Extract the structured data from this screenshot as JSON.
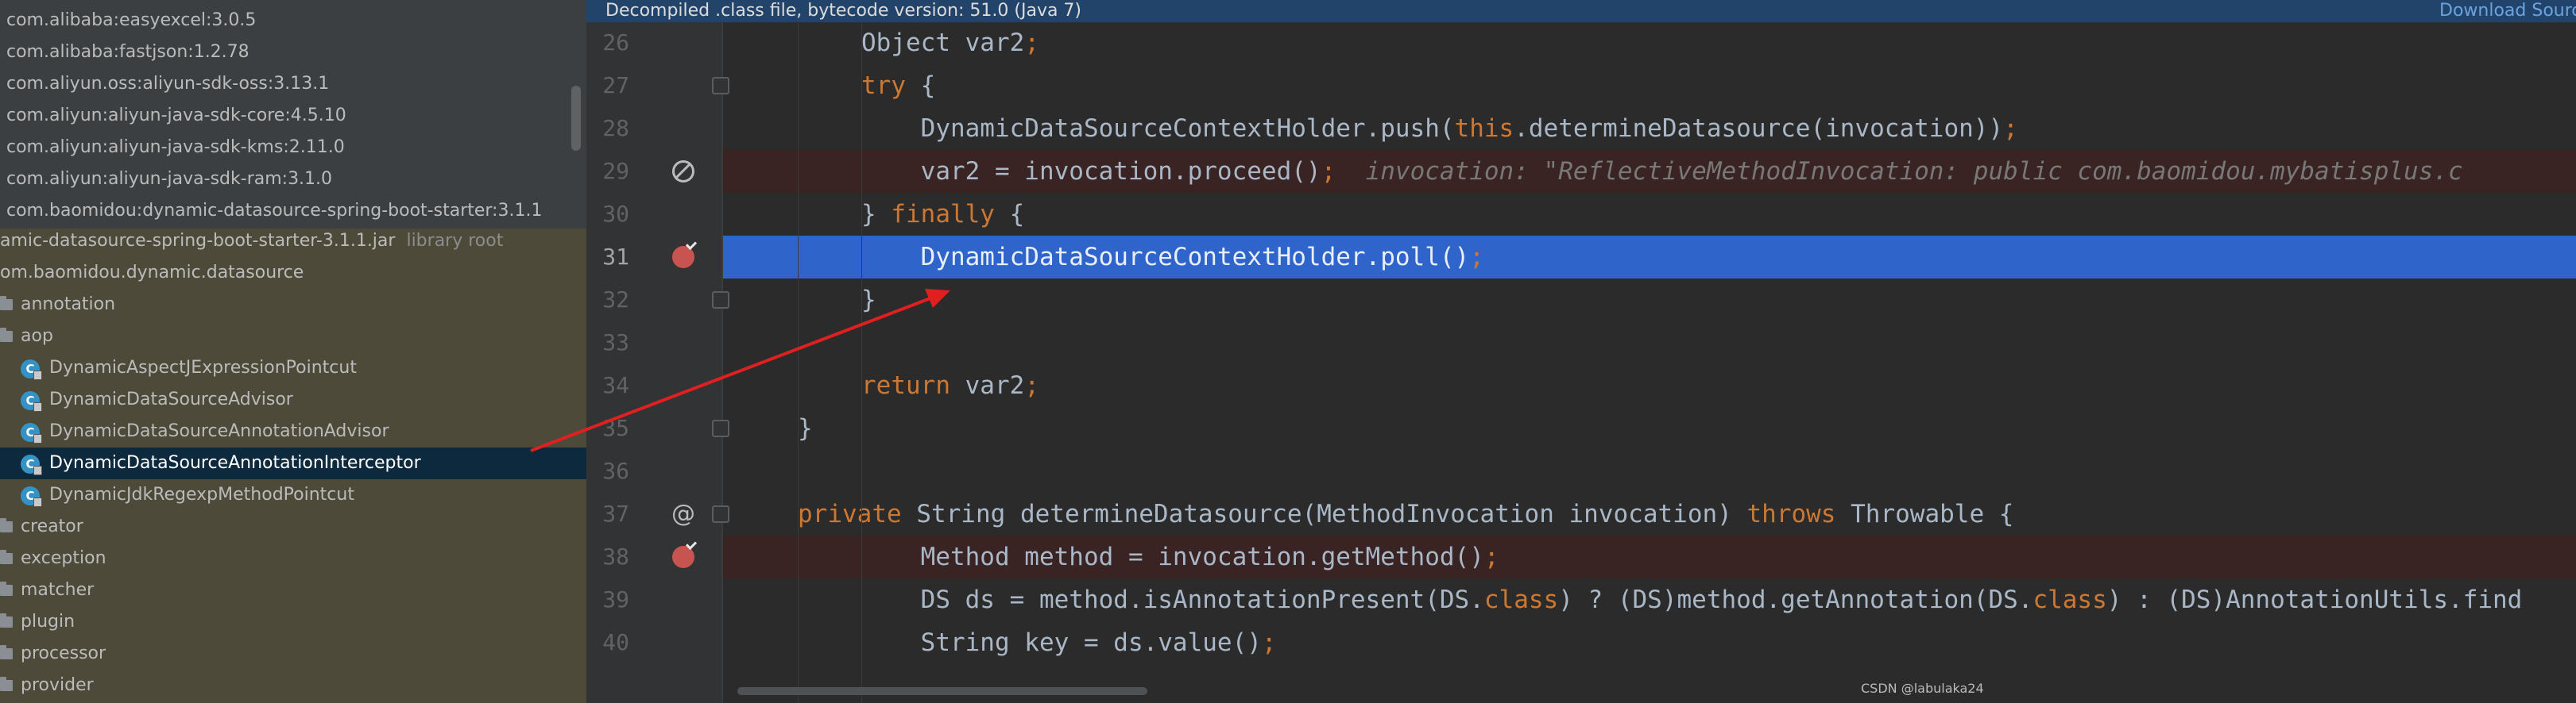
{
  "tree": {
    "dependencies": [
      "com.alibaba:easyexcel:3.0.5",
      "com.alibaba:fastjson:1.2.78",
      "com.aliyun.oss:aliyun-sdk-oss:3.13.1",
      "com.aliyun:aliyun-java-sdk-core:4.5.10",
      "com.aliyun:aliyun-java-sdk-kms:2.11.0",
      "com.aliyun:aliyun-java-sdk-ram:3.1.0",
      "com.baomidou:dynamic-datasource-spring-boot-starter:3.1.1"
    ],
    "jar": {
      "name": "amic-datasource-spring-boot-starter-3.1.1.jar",
      "hint": "library root"
    },
    "package": "om.baomidou.dynamic.datasource",
    "folders_top": [
      "annotation",
      "aop"
    ],
    "aop_classes": [
      "DynamicAspectJExpressionPointcut",
      "DynamicDataSourceAdvisor",
      "DynamicDataSourceAnnotationAdvisor",
      "DynamicDataSourceAnnotationInterceptor",
      "DynamicJdkRegexpMethodPointcut"
    ],
    "folders_bottom": [
      "creator",
      "exception",
      "matcher",
      "plugin",
      "processor",
      "provider"
    ],
    "class_icon_letter": "C",
    "selected": "DynamicDataSourceAnnotationInterceptor"
  },
  "editor": {
    "notice": "Decompiled .class file, bytecode version: 51.0 (Java 7)",
    "notice_link": "Download Sources",
    "lines": [
      {
        "n": "26",
        "parts": [
          {
            "t": "Object var2",
            "c": ""
          },
          {
            "t": ";",
            "c": "sc"
          }
        ]
      },
      {
        "n": "27",
        "parts": [
          {
            "t": "try",
            "c": "kw"
          },
          {
            "t": " {",
            "c": ""
          }
        ]
      },
      {
        "n": "28",
        "parts": [
          {
            "t": "    DynamicDataSourceContextHolder.push(",
            "c": ""
          },
          {
            "t": "this",
            "c": "kw"
          },
          {
            "t": ".determineDatasource(invocation))",
            "c": ""
          },
          {
            "t": ";",
            "c": "sc"
          }
        ]
      },
      {
        "n": "29",
        "parts": [
          {
            "t": "    var2 = invocation.proceed()",
            "c": ""
          },
          {
            "t": ";",
            "c": "sc"
          },
          {
            "t": "  invocation: \"ReflectiveMethodInvocation: public com.baomidou.mybatisplus.c",
            "c": "cm"
          }
        ]
      },
      {
        "n": "30",
        "parts": [
          {
            "t": "} ",
            "c": ""
          },
          {
            "t": "finally",
            "c": "kw"
          },
          {
            "t": " {",
            "c": ""
          }
        ]
      },
      {
        "n": "31",
        "parts": [
          {
            "t": "    DynamicDataSourceContextHolder.poll()",
            "c": ""
          },
          {
            "t": ";",
            "c": "sc"
          }
        ]
      },
      {
        "n": "32",
        "parts": [
          {
            "t": "}",
            "c": ""
          }
        ]
      },
      {
        "n": "33",
        "parts": []
      },
      {
        "n": "34",
        "parts": [
          {
            "t": "return",
            "c": "kw"
          },
          {
            "t": " var2",
            "c": ""
          },
          {
            "t": ";",
            "c": "sc"
          }
        ]
      },
      {
        "n": "35",
        "parts": [
          {
            "t": "}",
            "c": ""
          }
        ]
      },
      {
        "n": "36",
        "parts": []
      },
      {
        "n": "37",
        "parts": [
          {
            "t": "private",
            "c": "kw"
          },
          {
            "t": " String determineDatasource(MethodInvocation invocation) ",
            "c": ""
          },
          {
            "t": "throws",
            "c": "kw"
          },
          {
            "t": " Throwable {",
            "c": ""
          }
        ]
      },
      {
        "n": "38",
        "parts": [
          {
            "t": "    Method method = invocation.getMethod()",
            "c": ""
          },
          {
            "t": ";",
            "c": "sc"
          }
        ]
      },
      {
        "n": "39",
        "parts": [
          {
            "t": "    DS ds = method.isAnnotationPresent(DS.",
            "c": ""
          },
          {
            "t": "class",
            "c": "kw"
          },
          {
            "t": ") ? (DS)method.getAnnotation(DS.",
            "c": ""
          },
          {
            "t": "class",
            "c": "kw"
          },
          {
            "t": ") : (DS)AnnotationUtils.find",
            "c": ""
          }
        ]
      },
      {
        "n": "40",
        "parts": [
          {
            "t": "    String key = ds.value()",
            "c": ""
          },
          {
            "t": ";",
            "c": "sc"
          }
        ]
      }
    ],
    "gutter_markers": {
      "muted_breakpoint": "29",
      "breakpoints": [
        "31",
        "38"
      ],
      "override": "37"
    },
    "gutter_override_glyph": "@",
    "execution_line": "31",
    "breakpoint_lines": [
      "29",
      "38"
    ],
    "current_line": "31",
    "fold_lines": [
      "27",
      "32",
      "35",
      "37"
    ]
  },
  "watermark": "CSDN @labulaka24",
  "colors": {
    "arrow": "#e02020",
    "selection": "#0d293e",
    "exec_line": "#2f65ca"
  }
}
